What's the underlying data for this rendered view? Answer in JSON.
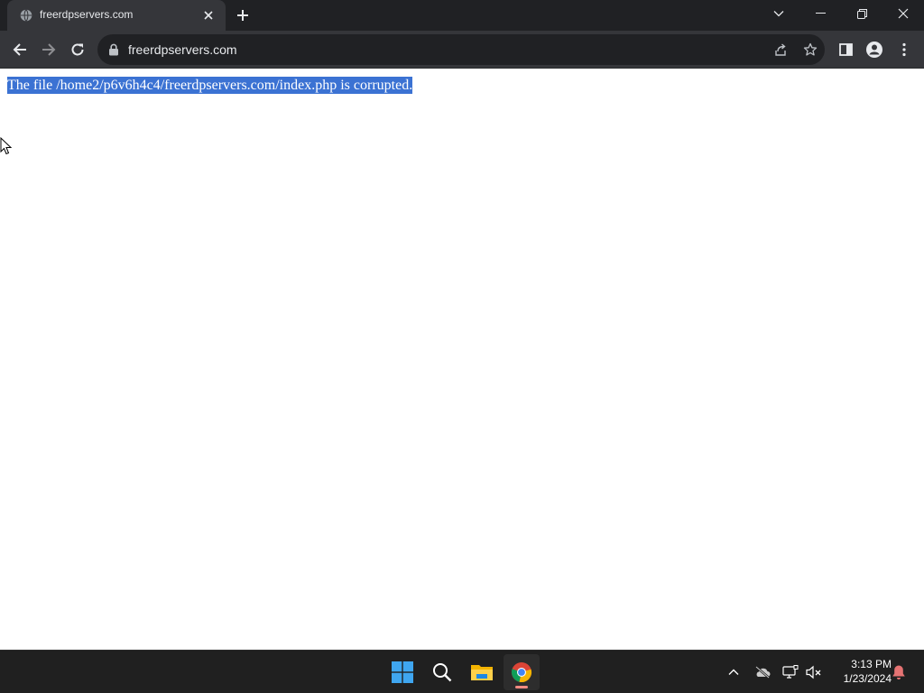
{
  "browser": {
    "tab": {
      "title": "freerdpservers.com",
      "favicon": "globe-icon",
      "close_icon": "close-icon"
    },
    "new_tab_icon": "plus-icon",
    "window_controls": [
      "tab-search-icon",
      "minimize-icon",
      "restore-icon",
      "close-icon"
    ],
    "nav": {
      "back_icon": "back-arrow-icon",
      "forward_icon": "forward-arrow-icon",
      "reload_icon": "reload-icon"
    },
    "omnibox": {
      "url": "freerdpservers.com",
      "lock_icon": "lock-icon",
      "share_icon": "share-icon",
      "bookmark_icon": "star-icon"
    },
    "toolbar_right": [
      "side-panel-icon",
      "profile-icon",
      "menu-kebab-icon"
    ],
    "colors": {
      "frame": "#202124",
      "toolbar": "#35363a",
      "text": "#e8eaed"
    }
  },
  "page": {
    "message": "The file /home2/p6v6h4c4/freerdpservers.com/index.php is corrupted.",
    "selection_color": "#3b72d3"
  },
  "taskbar": {
    "pinned": [
      "windows-start-icon",
      "search-icon",
      "file-explorer-icon",
      "chrome-icon"
    ],
    "active": "chrome-icon",
    "tray": [
      "chevron-up-icon",
      "onedrive-offline-icon",
      "network-icon",
      "volume-muted-icon"
    ],
    "time": "3:13 PM",
    "date": "1/23/2024",
    "notification_icon": "bell-icon"
  }
}
